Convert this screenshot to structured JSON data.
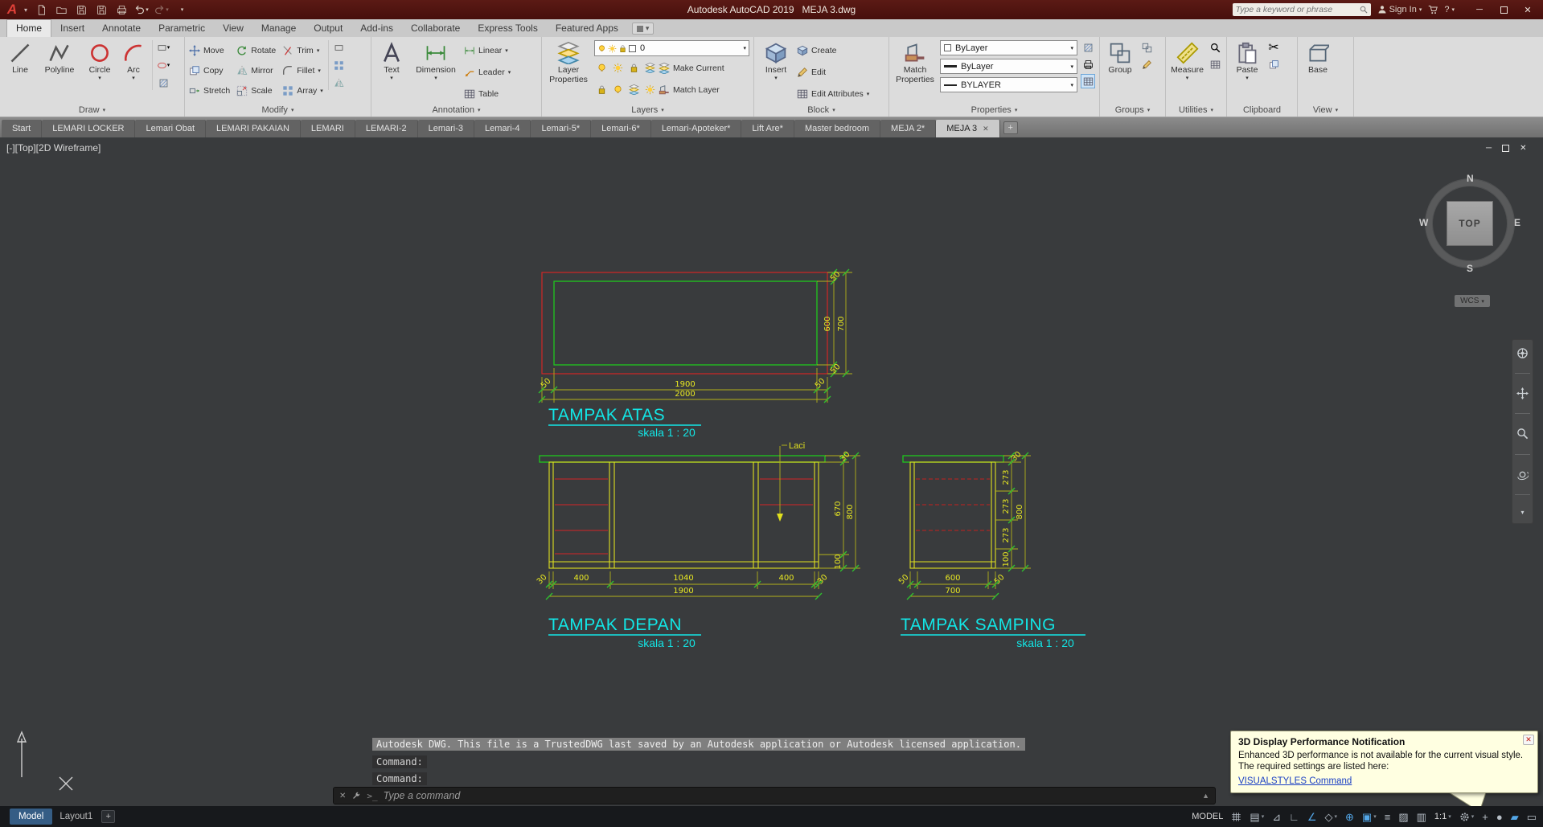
{
  "titlebar": {
    "app_button": "A",
    "title": "Autodesk AutoCAD 2019   MEJA 3.dwg",
    "search_placeholder": "Type a keyword or phrase",
    "sign_in": "Sign In",
    "help": "?"
  },
  "ribbon": {
    "tabs": [
      "Home",
      "Insert",
      "Annotate",
      "Parametric",
      "View",
      "Manage",
      "Output",
      "Add-ins",
      "Collaborate",
      "Express Tools",
      "Featured Apps"
    ],
    "panels": {
      "draw": {
        "label": "Draw",
        "line": "Line",
        "polyline": "Polyline",
        "circle": "Circle",
        "arc": "Arc"
      },
      "modify": {
        "label": "Modify",
        "move": "Move",
        "rotate": "Rotate",
        "trim": "Trim",
        "copy": "Copy",
        "mirror": "Mirror",
        "fillet": "Fillet",
        "stretch": "Stretch",
        "scale": "Scale",
        "array": "Array"
      },
      "annotation": {
        "label": "Annotation",
        "text": "Text",
        "dimension": "Dimension",
        "linear": "Linear",
        "leader": "Leader",
        "table": "Table"
      },
      "layers": {
        "label": "Layers",
        "layer_properties": "Layer Properties",
        "current_layer": "0",
        "make_current": "Make Current",
        "match_layer": "Match Layer"
      },
      "block": {
        "label": "Block",
        "insert": "Insert",
        "create": "Create",
        "edit": "Edit",
        "edit_attributes": "Edit Attributes"
      },
      "properties": {
        "label": "Properties",
        "match_properties": "Match Properties",
        "color": "ByLayer",
        "lineweight": "ByLayer",
        "linetype": "BYLAYER"
      },
      "groups": {
        "label": "Groups",
        "group": "Group"
      },
      "utilities": {
        "label": "Utilities",
        "measure": "Measure"
      },
      "clipboard": {
        "label": "Clipboard",
        "paste": "Paste"
      },
      "view": {
        "label": "View",
        "base": "Base"
      }
    }
  },
  "file_tabs": [
    "Start",
    "LEMARI LOCKER",
    "Lemari Obat",
    "LEMARI PAKAIAN",
    "LEMARI",
    "LEMARI-2",
    "Lemari-3",
    "Lemari-4",
    "Lemari-5*",
    "Lemari-6*",
    "Lemari-Apoteker*",
    "Lift Are*",
    "Master bedroom",
    "MEJA 2*",
    "MEJA 3"
  ],
  "viewport": {
    "label": "[-][Top][2D Wireframe]"
  },
  "view_tools": {
    "wcs": "WCS",
    "compass": {
      "n": "N",
      "e": "E",
      "s": "S",
      "w": "W",
      "face": "TOP"
    }
  },
  "drawing": {
    "tampak_atas": {
      "title": "TAMPAK ATAS",
      "scale_label": "skala 1 : 20",
      "dim_width_inner": "1900",
      "dim_width_outer": "2000",
      "dim_left": "50",
      "dim_right": "50",
      "dim_top": "50",
      "dim_bottom": "50",
      "dim_height_inner": "600",
      "dim_height_outer": "700"
    },
    "tampak_depan": {
      "title": "TAMPAK DEPAN",
      "scale_label": "skala 1 : 20",
      "callout": "Laci",
      "dim_b1": "30",
      "dim_b2": "400",
      "dim_b3": "1040",
      "dim_b4": "400",
      "dim_b5": "30",
      "dim_total": "1900",
      "dim_r_top": "30",
      "dim_r_mid": "670",
      "dim_r_bottom": "100",
      "dim_r_total": "800"
    },
    "tampak_samping": {
      "title": "TAMPAK SAMPING",
      "scale_label": "skala 1 : 20",
      "dim_b1": "50",
      "dim_b2": "600",
      "dim_b3": "50",
      "dim_total": "700",
      "dim_r_top": "30",
      "dim_r1": "273",
      "dim_r2": "273",
      "dim_r3": "273",
      "dim_r_bottom": "100",
      "dim_r_total": "800"
    }
  },
  "command": {
    "history1": "Autodesk DWG.  This file is a TrustedDWG last saved by an Autodesk application or Autodesk licensed application.",
    "history2": "Command:",
    "history3": "Command:",
    "input_placeholder": "Type a command"
  },
  "notification": {
    "title": "3D Display Performance Notification",
    "body1": "Enhanced 3D performance is not available for the current visual style.",
    "body2": "The required settings are listed here:",
    "link_label": "VISUALSTYLES Command"
  },
  "statusbar": {
    "model_tab": "Model",
    "layout_tab": "Layout1",
    "new_layout": "+",
    "space_label": "MODEL",
    "annotation_scale": "1:1"
  }
}
